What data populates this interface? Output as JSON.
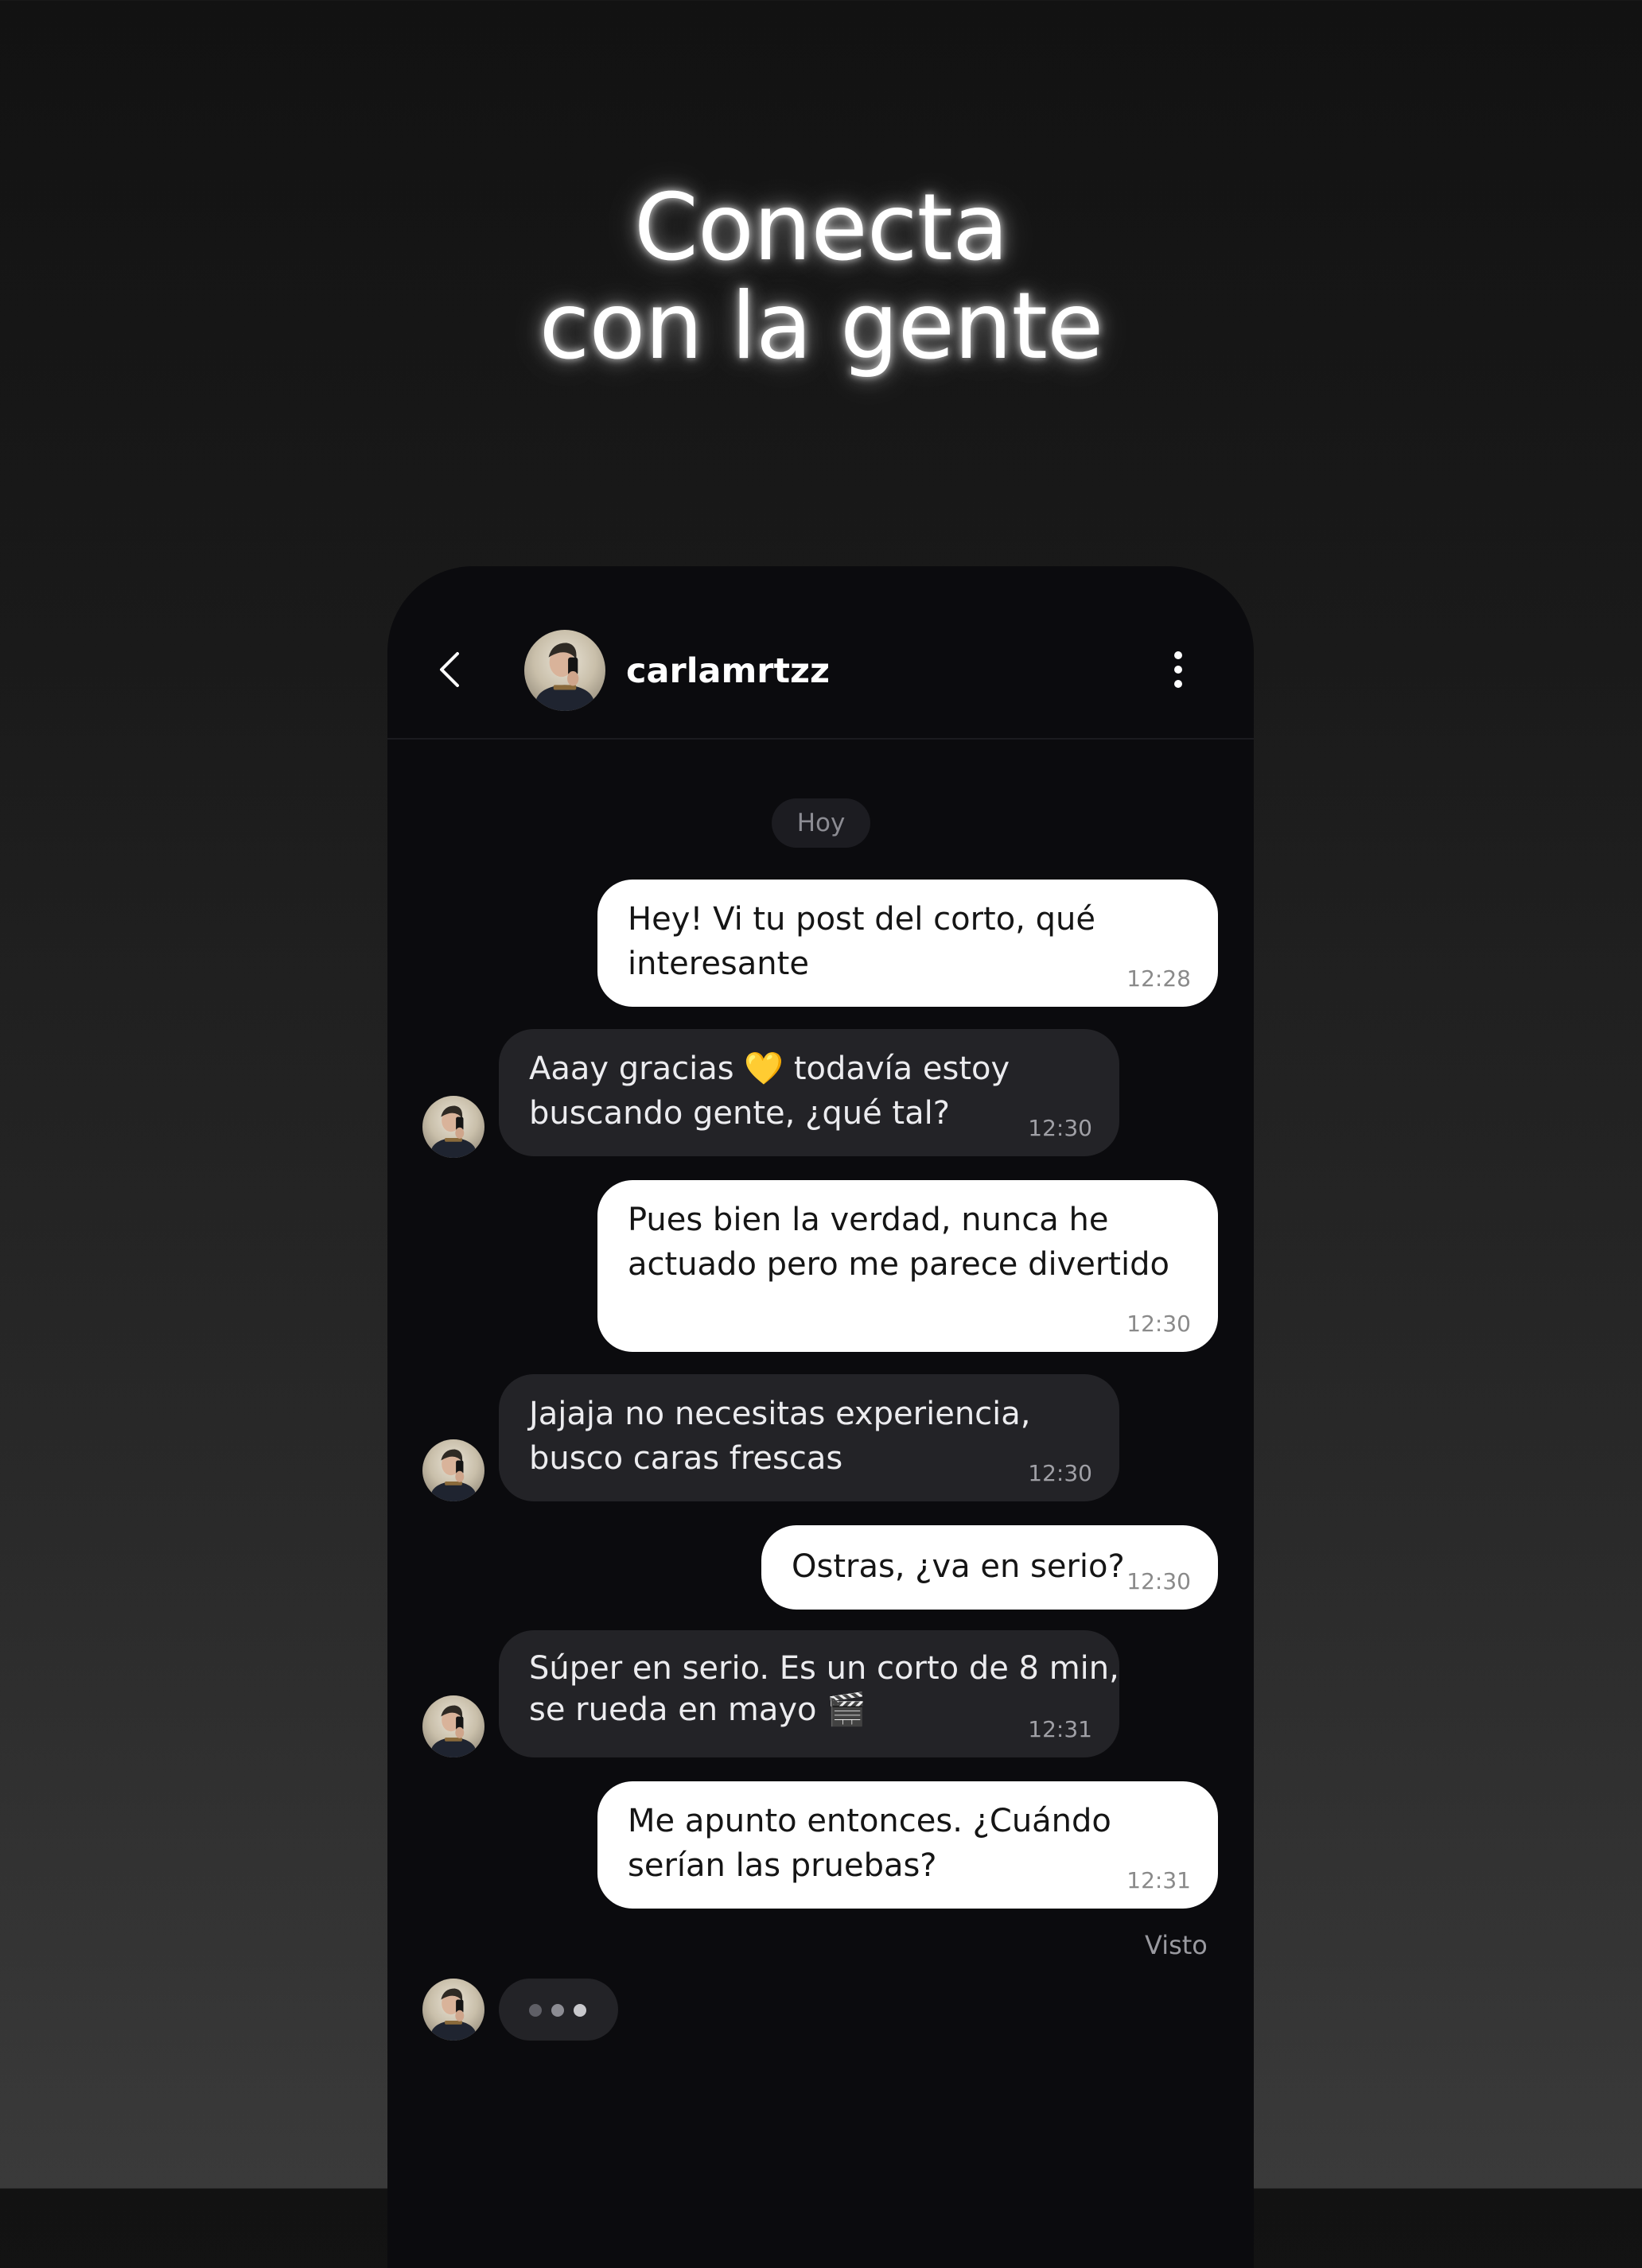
{
  "headline": {
    "line1": "Conecta",
    "line2": "con la gente"
  },
  "chat": {
    "header": {
      "username": "carlamrtzz",
      "back_icon": "chevron-left-icon",
      "menu_icon": "more-vertical-icon"
    },
    "day_label": "Hoy",
    "messages": [
      {
        "direction": "out",
        "lines": [
          "Hey! Vi tu post del corto, qué",
          "interesante"
        ],
        "time": "12:28"
      },
      {
        "direction": "in",
        "lines": [
          "Aaay gracias 💛 todavía estoy",
          "buscando gente, ¿qué tal?"
        ],
        "time": "12:30"
      },
      {
        "direction": "out",
        "lines": [
          "Pues bien la verdad, nunca he",
          "actuado pero me parece divertido"
        ],
        "time": "12:30"
      },
      {
        "direction": "in",
        "lines": [
          "Jajaja no necesitas experiencia,",
          "busco caras frescas"
        ],
        "time": "12:30"
      },
      {
        "direction": "out",
        "lines": [
          "Ostras, ¿va en serio?"
        ],
        "time": "12:30"
      },
      {
        "direction": "in",
        "lines": [
          "Súper en serio. Es un corto de 8 min,",
          "se rueda en mayo 🎬"
        ],
        "time": "12:31"
      },
      {
        "direction": "out",
        "lines": [
          "Me apunto entonces. ¿Cuándo",
          "serían las pruebas?"
        ],
        "time": "12:31"
      }
    ],
    "seen_label": "Visto",
    "typing_indicator": true
  },
  "colors": {
    "outgoing_bubble": "#ffffff",
    "incoming_bubble": "#232327",
    "chat_background": "#0b0b0e"
  }
}
